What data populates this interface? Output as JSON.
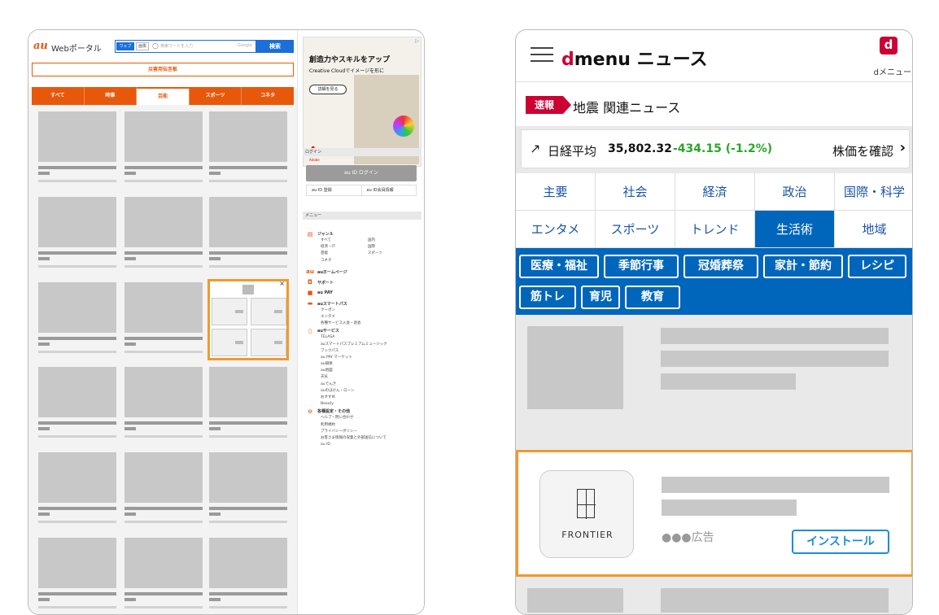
{
  "au_portal": {
    "logo": "au",
    "logo_sub": "Webポータル",
    "search": {
      "tab_web": "ウェブ",
      "tab_image": "画像",
      "placeholder": "検索ワードを入力",
      "provider": "Google",
      "button": "検索"
    },
    "disaster_banner": "災害用伝言板",
    "tabs": [
      "すべて",
      "時事",
      "芸能",
      "スポーツ",
      "コネタ"
    ],
    "active_tab": "芸能",
    "ad": {
      "title": "創造力やスキルをアップ",
      "subtitle": "Creative Cloudでイメージを形に",
      "button": "詳細を見る",
      "brand": "Adobe"
    },
    "login": {
      "header": "ログイン",
      "button": "au ID ログイン",
      "register": "au ID 登録",
      "member": "au ID会員情報"
    },
    "menu": {
      "header": "メニュー",
      "genre": "ジャンル",
      "genre_items": [
        [
          "すべて",
          "国内"
        ],
        [
          "経済・IT",
          "国際"
        ],
        [
          "芸能",
          "スポーツ"
        ],
        [
          "コネタ",
          ""
        ]
      ],
      "sections": [
        {
          "icon": "au-home-icon",
          "label": "auホームページ",
          "items": []
        },
        {
          "icon": "support-icon",
          "label": "サポート",
          "items": []
        },
        {
          "icon": "au-pay-icon",
          "label": "au PAY",
          "items": []
        },
        {
          "icon": "smartpass-icon",
          "label": "auスマートパス",
          "items": [
            "クーポン",
            "エンタメ",
            "各種サービス入会・退会"
          ]
        },
        {
          "icon": "au-service-icon",
          "label": "auサービス",
          "items": [
            "TELASA",
            "auスマートパスプレミアムミュージック",
            "ブックパス",
            "au PAY マーケット",
            "au損保",
            "au地図",
            "天気",
            "auでんき",
            "auのほけん・ローン",
            "おすすめ",
            "Beauty"
          ]
        },
        {
          "icon": "settings-icon",
          "label": "各種設定・その他",
          "items": [
            "ヘルプ・問い合わせ",
            "利用規約",
            "プライバシーポリシー",
            "お客さま情報の収集と外部送信について",
            "au ID"
          ]
        }
      ]
    }
  },
  "dmenu": {
    "logo_d": "d",
    "logo_rest": "menu",
    "logo_news": "ニュース",
    "app_icon": "d",
    "app_label": "dメニュー",
    "breaking_tag": "速報",
    "breaking_text": "地震 関連ニュース",
    "stock": {
      "label": "日経平均",
      "value": "35,802.32",
      "change": "-434.15 (-1.2%)",
      "link": "株価を確認",
      "change_color": "#2aa62a"
    },
    "tabs": [
      "主要",
      "社会",
      "経済",
      "政治",
      "国際・科学",
      "エンタメ",
      "スポーツ",
      "トレンド",
      "生活術",
      "地域"
    ],
    "active_tab": "生活術",
    "subcategories": [
      "医療・福祉",
      "季節行事",
      "冠婚葬祭",
      "家計・節約",
      "レシピ",
      "筋トレ",
      "育児",
      "教育"
    ],
    "ad": {
      "brand": "FRONTIER",
      "label": "●●●広告",
      "button": "インストール"
    },
    "accent": "#cc0033",
    "primary": "#0066bb"
  }
}
